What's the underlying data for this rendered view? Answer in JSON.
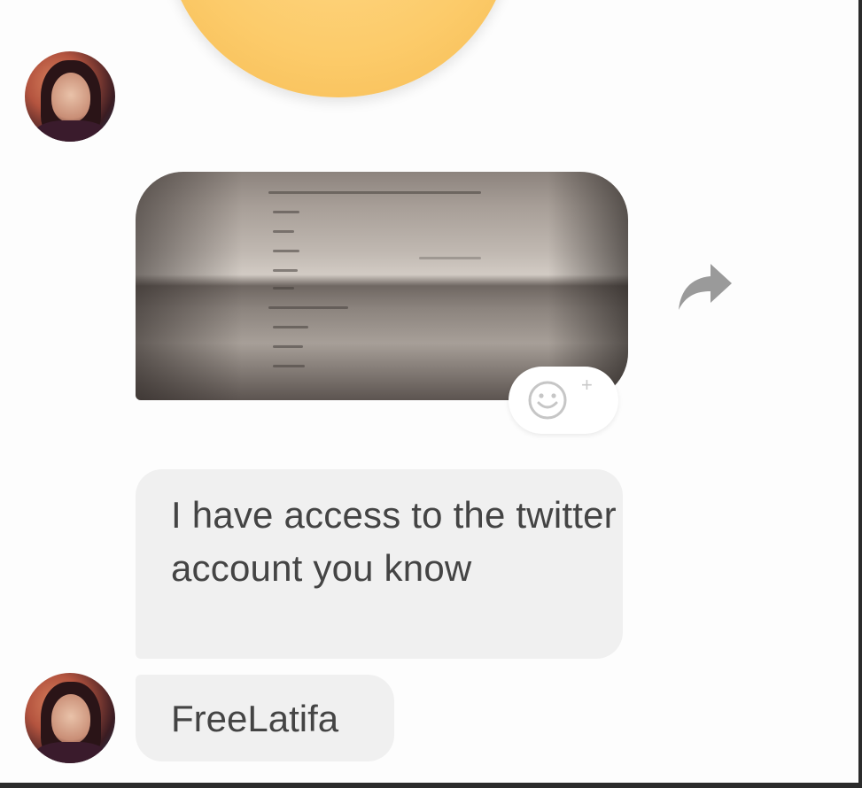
{
  "conversation": {
    "messages": [
      {
        "type": "sticker",
        "icon": "yellow-emoji-sticker"
      },
      {
        "type": "image",
        "description_icon": "photo-attachment"
      },
      {
        "type": "text",
        "text": "I have access to the twitter account you know"
      },
      {
        "type": "text",
        "text": "FreeLatifa"
      }
    ],
    "actions": {
      "react_icon": "smiley-add-icon",
      "react_plus": "+",
      "share_icon": "share-forward-icon"
    }
  },
  "colors": {
    "bubble_bg": "#f0f0f0",
    "text": "#444444",
    "icon_gray": "#9a9a9a",
    "sticker_yellow": "#fccb6a"
  }
}
